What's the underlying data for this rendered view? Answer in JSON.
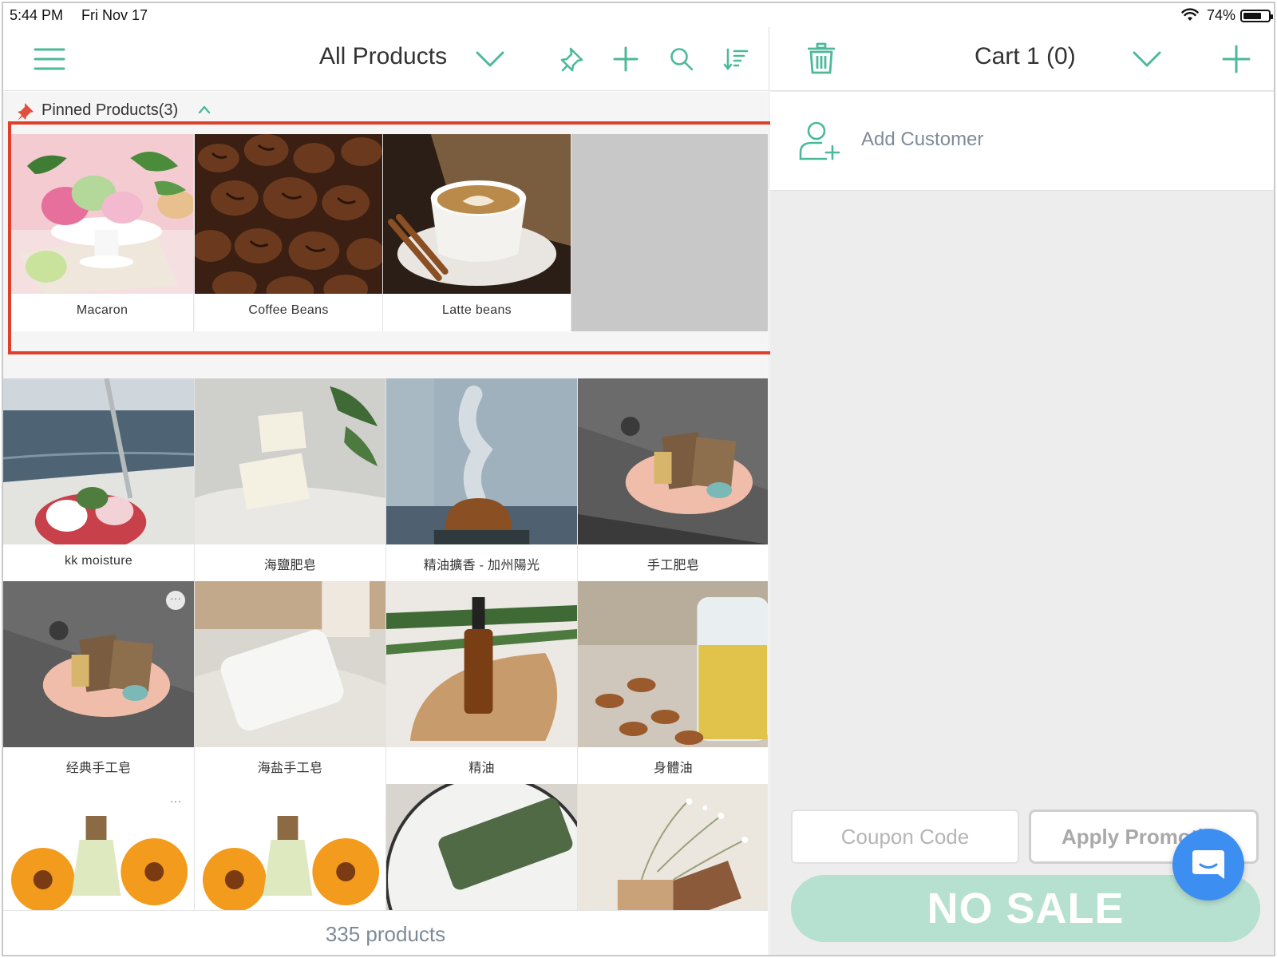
{
  "status_bar": {
    "time": "5:44 PM",
    "date": "Fri Nov 17",
    "battery": "74%",
    "battery_level": 0.74
  },
  "left_toolbar": {
    "title": "All Products",
    "icons": [
      "menu-icon",
      "chevron-down-icon",
      "pin-icon",
      "plus-icon",
      "search-icon",
      "sort-icon"
    ]
  },
  "pinned": {
    "label": "Pinned Products(3)",
    "items": [
      {
        "name": "Macaron"
      },
      {
        "name": "Coffee Beans"
      },
      {
        "name": "Latte beans"
      }
    ]
  },
  "products": [
    {
      "name": "kk moisture"
    },
    {
      "name": "海鹽肥皂"
    },
    {
      "name": "精油擴香 - 加州陽光"
    },
    {
      "name": "手工肥皂"
    },
    {
      "name": "经典手工皂"
    },
    {
      "name": "海盐手工皂"
    },
    {
      "name": "精油"
    },
    {
      "name": "身體油"
    },
    {
      "name": ""
    },
    {
      "name": ""
    },
    {
      "name": ""
    },
    {
      "name": ""
    }
  ],
  "footer": {
    "count_label": "335 products"
  },
  "cart": {
    "title": "Cart 1 (0)",
    "add_customer": "Add Customer",
    "coupon_placeholder": "Coupon Code",
    "apply_label": "Apply Promotion",
    "nosale_label": "NO SALE"
  },
  "colors": {
    "accent": "#4cb99a",
    "highlight": "#e0402a",
    "nosale": "#b6e0cf",
    "chat": "#3c8ff0"
  }
}
